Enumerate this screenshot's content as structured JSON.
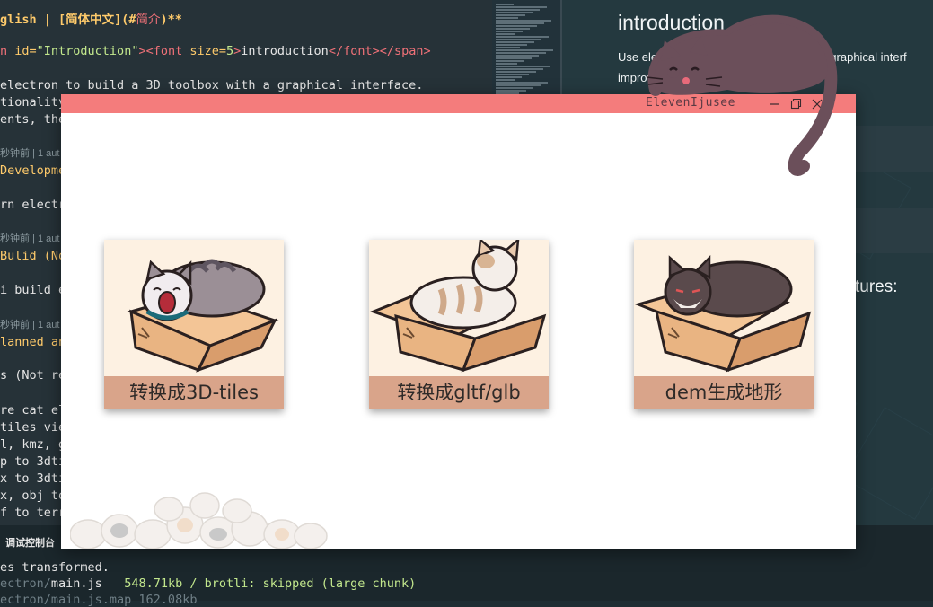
{
  "editor": {
    "lines": [
      {
        "segments": [
          {
            "t": "glish | [",
            "c": "c-head"
          },
          {
            "t": "简体中文",
            "c": "c-head"
          },
          {
            "t": "](#",
            "c": "c-head"
          },
          {
            "t": "简介",
            "c": "c-link"
          },
          {
            "t": ")**",
            "c": "c-head"
          }
        ]
      },
      {
        "segments": [
          {
            "t": "n ",
            "c": "c-tag"
          },
          {
            "t": "id=",
            "c": "c-attr"
          },
          {
            "t": "\"Introduction\"",
            "c": "c-str"
          },
          {
            "t": "><",
            "c": "c-tag"
          },
          {
            "t": "font ",
            "c": "c-tag"
          },
          {
            "t": "size=",
            "c": "c-attr"
          },
          {
            "t": "5",
            "c": "c-str"
          },
          {
            "t": ">",
            "c": "c-tag"
          },
          {
            "t": "introduction",
            "c": "c-text"
          },
          {
            "t": "</font></span>",
            "c": "c-tag"
          }
        ]
      },
      {
        "segments": [
          {
            "t": "electron to build a 3D toolbox with a graphical interface.",
            "c": "c-text"
          }
        ]
      },
      {
        "segments": [
          {
            "t": "tionality",
            "c": "c-text"
          }
        ]
      },
      {
        "segments": [
          {
            "t": "ents, the",
            "c": "c-text"
          }
        ]
      },
      {
        "segments": [
          {
            "t": "秒钟前 | 1 aut",
            "c": "c-meta"
          }
        ]
      },
      {
        "segments": [
          {
            "t": "Developme",
            "c": "c-yellow"
          }
        ]
      },
      {
        "segments": [
          {
            "t": "rn electr",
            "c": "c-text"
          }
        ]
      },
      {
        "segments": [
          {
            "t": "秒钟前 | 1 aut",
            "c": "c-meta"
          }
        ]
      },
      {
        "segments": [
          {
            "t": "Bulid (No",
            "c": "c-yellow"
          }
        ]
      },
      {
        "segments": [
          {
            "t": "i build e",
            "c": "c-text"
          }
        ]
      },
      {
        "segments": [
          {
            "t": "秒钟前 | 1 aut",
            "c": "c-meta"
          }
        ]
      },
      {
        "segments": [
          {
            "t": "lanned an",
            "c": "c-yellow"
          }
        ]
      },
      {
        "segments": [
          {
            "t": "s (Not re",
            "c": "c-text"
          }
        ]
      },
      {
        "segments": [
          {
            "t": "re cat el",
            "c": "c-text"
          }
        ]
      },
      {
        "segments": [
          {
            "t": "tiles vie",
            "c": "c-text"
          }
        ]
      },
      {
        "segments": [
          {
            "t": "l, kmz, g",
            "c": "c-text"
          }
        ]
      },
      {
        "segments": [
          {
            "t": "p to 3dti",
            "c": "c-text"
          }
        ]
      },
      {
        "segments": [
          {
            "t": "x to 3dti",
            "c": "c-text"
          }
        ]
      },
      {
        "segments": [
          {
            "t": "x, obj to",
            "c": "c-text"
          }
        ]
      },
      {
        "segments": [
          {
            "t": "f to terr",
            "c": "c-text"
          }
        ]
      }
    ]
  },
  "preview": {
    "title": "introduction",
    "para1": "Use electron to build a 3D toolbox with a graphical interf",
    "para2": "improve                                 biggest feature is",
    "features_fragment": "tures:"
  },
  "terminal": {
    "tab_label": "调试控制台",
    "lines": [
      {
        "segments": [
          {
            "t": "es transformed.",
            "c": "t-white"
          }
        ]
      },
      {
        "segments": [
          {
            "t": "ectron/",
            "c": "t-dim"
          },
          {
            "t": "main.js",
            "c": "t-white"
          },
          {
            "t": "   548.71kb / brotli: skipped (large chunk)",
            "c": "t-green"
          }
        ]
      },
      {
        "segments": [
          {
            "t": "ectron/main.js.map 162.08kb",
            "c": "t-dim"
          }
        ]
      }
    ]
  },
  "app": {
    "title": "ElevenIjusee",
    "window_buttons": [
      "minimize-icon",
      "restore-icon",
      "close-icon"
    ],
    "cards": [
      {
        "label": "转换成3D-tiles",
        "cat": "grey-tabby"
      },
      {
        "label": "转换成gltf/glb",
        "cat": "cream-calico"
      },
      {
        "label": "dem生成地形",
        "cat": "dark-brown"
      }
    ],
    "colors": {
      "titlebar": "#f47c7c",
      "card_label_bg": "#d9a48a",
      "card_bg": "#fdf1e2"
    }
  }
}
